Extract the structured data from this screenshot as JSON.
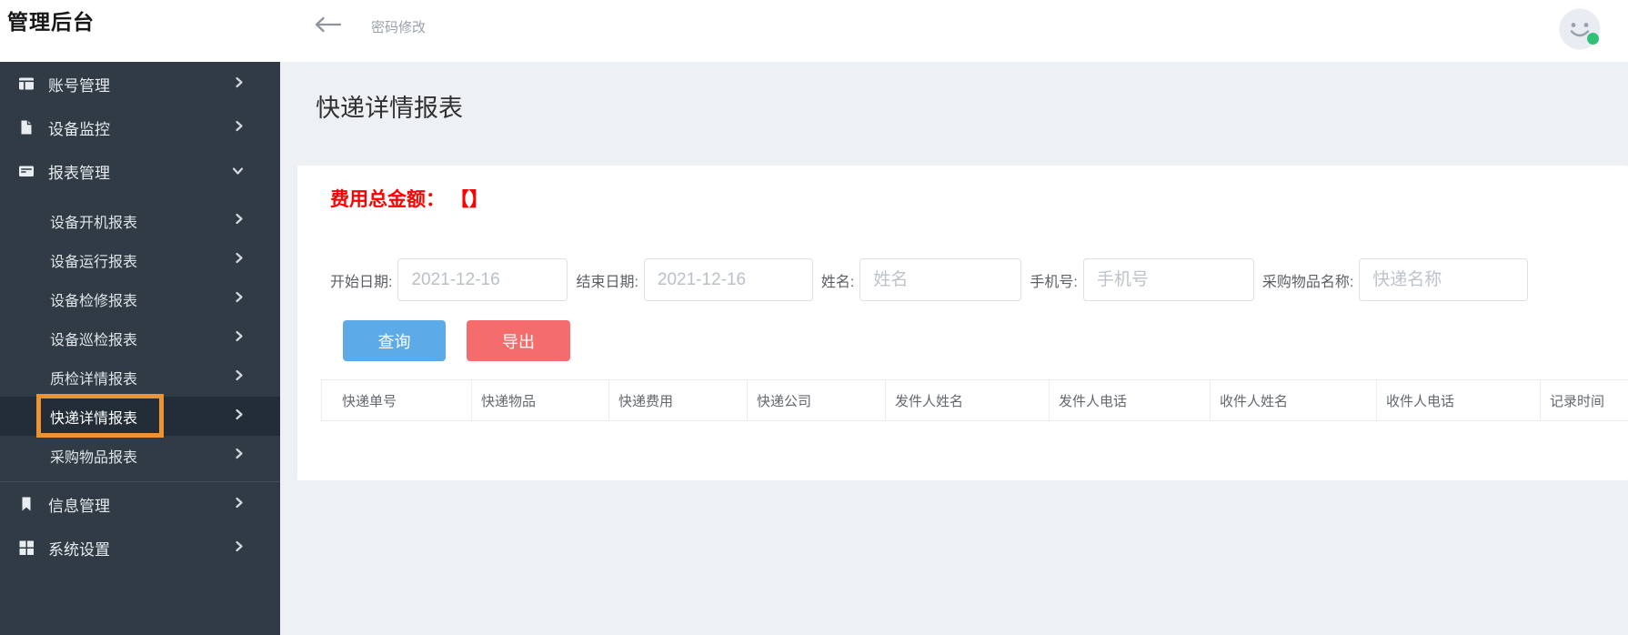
{
  "header": {
    "app_title": "管理后台",
    "breadcrumb": "密码修改"
  },
  "sidebar": {
    "items": [
      {
        "label": "账号管理",
        "icon": "account-panel-icon",
        "chevron": "right"
      },
      {
        "label": "设备监控",
        "icon": "device-file-icon",
        "chevron": "right"
      },
      {
        "label": "报表管理",
        "icon": "report-card-icon",
        "chevron": "down",
        "expanded": true,
        "children": [
          {
            "label": "设备开机报表"
          },
          {
            "label": "设备运行报表"
          },
          {
            "label": "设备检修报表"
          },
          {
            "label": "设备巡检报表"
          },
          {
            "label": "质检详情报表"
          },
          {
            "label": "快递详情报表",
            "selected": true,
            "highlighted": true
          },
          {
            "label": "采购物品报表"
          }
        ]
      },
      {
        "label": "信息管理",
        "icon": "bookmark-icon",
        "chevron": "right"
      },
      {
        "label": "系统设置",
        "icon": "grid-icon",
        "chevron": "right"
      }
    ]
  },
  "main": {
    "page_title": "快递详情报表",
    "total_fee_text": "费用总金额： 【】",
    "filters": [
      {
        "label": "开始日期:",
        "value": "2021-12-16"
      },
      {
        "label": "结束日期:",
        "value": "2021-12-16"
      },
      {
        "label": "姓名:",
        "placeholder": "姓名"
      },
      {
        "label": "手机号:",
        "placeholder": "手机号"
      },
      {
        "label": "采购物品名称:",
        "placeholder": "快递名称"
      }
    ],
    "buttons": {
      "query": "查询",
      "export": "导出"
    },
    "table": {
      "columns": [
        "快递单号",
        "快递物品",
        "快递费用",
        "快递公司",
        "发件人姓名",
        "发件人电话",
        "收件人姓名",
        "收件人电话",
        "记录时间"
      ],
      "rows": []
    }
  },
  "annotation": {
    "type": "highlight-box",
    "target": "快递详情报表",
    "color": "#ec9434"
  },
  "colors": {
    "sidebar_bg": "#303b46",
    "sidebar_selected_bg": "#232d37",
    "primary_button": "#5caae8",
    "danger_button": "#f56c6c",
    "total_fee_red": "#fe0000",
    "page_bg": "#eef1f4",
    "online_dot": "#30c178"
  }
}
